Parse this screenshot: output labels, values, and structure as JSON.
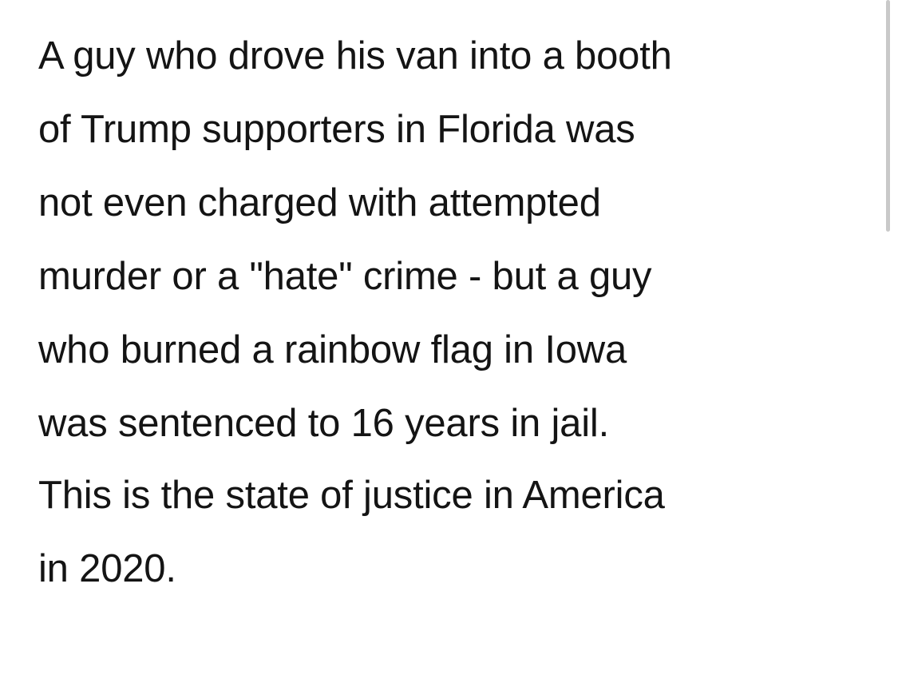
{
  "post": {
    "paragraphs": [
      {
        "lines": [
          "A guy who drove his van into a booth",
          "of Trump supporters in Florida was",
          "not even charged with attempted",
          "murder or a \"hate\" crime - but a guy",
          "who burned a rainbow flag in Iowa",
          "was sentenced to 16 years in jail."
        ]
      },
      {
        "lines": [
          "This is the state of justice in America",
          "in 2020."
        ]
      }
    ]
  },
  "colors": {
    "background": "#ffffff",
    "text": "#141414",
    "scrollbar": "#c9c9c9"
  }
}
